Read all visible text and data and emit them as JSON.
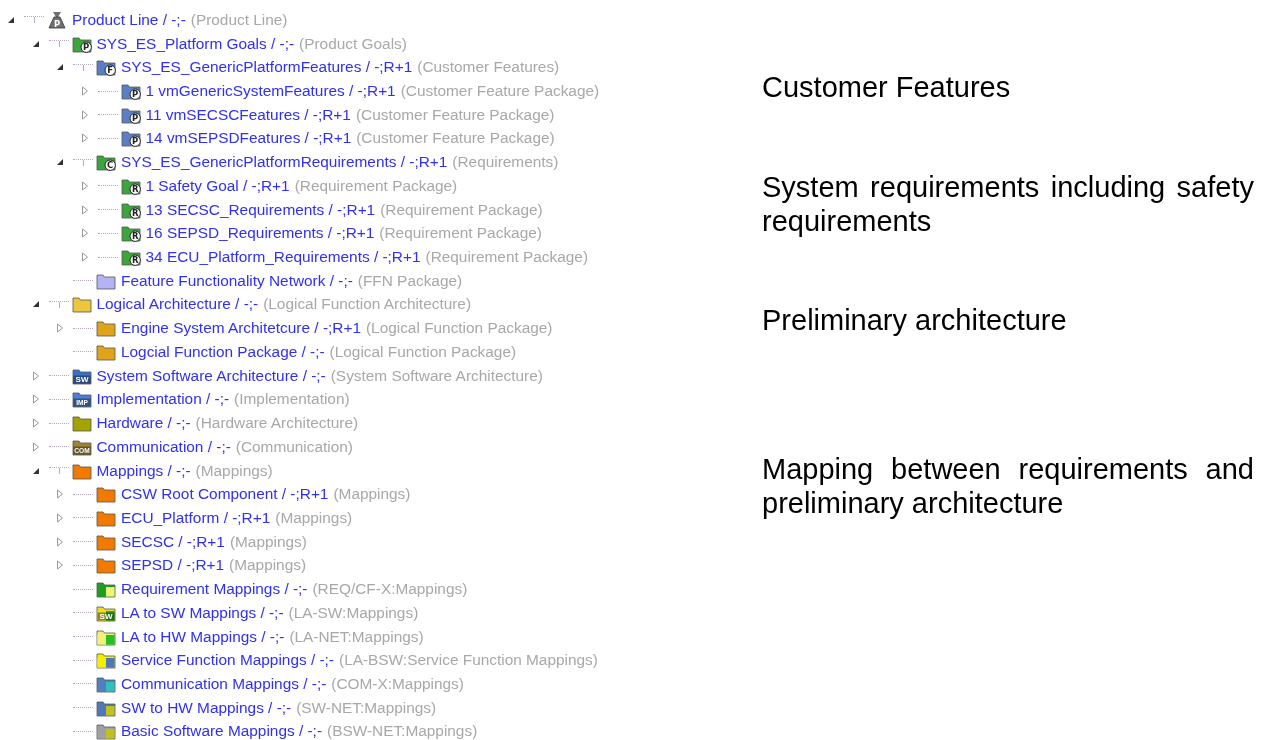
{
  "tree": [
    {
      "name": "Product Line / -;-",
      "type": "(Product Line)",
      "expanded": true,
      "icon": {
        "kind": "weight",
        "color": "#707070",
        "badge": "P"
      },
      "children": [
        {
          "name": "SYS_ES_Platform Goals / -;-",
          "type": "(Product Goals)",
          "expanded": true,
          "icon": {
            "kind": "badged",
            "color": "#3ca53c",
            "badge": "P"
          },
          "children": [
            {
              "name": "SYS_ES_GenericPlatformFeatures / -;R+1",
              "type": "(Customer Features)",
              "expanded": true,
              "icon": {
                "kind": "badged",
                "color": "#5a7fc6",
                "badge": "F"
              },
              "children": [
                {
                  "name": "1 vmGenericSystemFeatures / -;R+1",
                  "type": "(Customer Feature Package)",
                  "expanded": false,
                  "icon": {
                    "kind": "badged",
                    "color": "#5a7fc6",
                    "badge": "P"
                  }
                },
                {
                  "name": "11 vmSECSCFeatures / -;R+1",
                  "type": "(Customer Feature Package)",
                  "expanded": false,
                  "icon": {
                    "kind": "badged",
                    "color": "#5a7fc6",
                    "badge": "P"
                  }
                },
                {
                  "name": "14 vmSEPSDFeatures / -;R+1",
                  "type": "(Customer Feature Package)",
                  "expanded": false,
                  "icon": {
                    "kind": "badged",
                    "color": "#5a7fc6",
                    "badge": "P"
                  }
                }
              ]
            },
            {
              "name": "SYS_ES_GenericPlatformRequirements / -;R+1",
              "type": "(Requirements)",
              "expanded": true,
              "icon": {
                "kind": "badged",
                "color": "#3ca53c",
                "badge": "C"
              },
              "children": [
                {
                  "name": "1 Safety Goal / -;R+1",
                  "type": "(Requirement Package)",
                  "expanded": false,
                  "icon": {
                    "kind": "badged",
                    "color": "#3ca53c",
                    "badge": "R"
                  }
                },
                {
                  "name": "13 SECSC_Requirements / -;R+1",
                  "type": "(Requirement Package)",
                  "expanded": false,
                  "icon": {
                    "kind": "badged",
                    "color": "#3ca53c",
                    "badge": "R"
                  }
                },
                {
                  "name": "16 SEPSD_Requirements / -;R+1",
                  "type": "(Requirement Package)",
                  "expanded": false,
                  "icon": {
                    "kind": "badged",
                    "color": "#3ca53c",
                    "badge": "R"
                  }
                },
                {
                  "name": "34 ECU_Platform_Requirements / -;R+1",
                  "type": "(Requirement Package)",
                  "expanded": false,
                  "icon": {
                    "kind": "badged",
                    "color": "#3ca53c",
                    "badge": "R"
                  }
                }
              ]
            },
            {
              "name": "Feature Functionality Network / -;-",
              "type": "(FFN Package)",
              "icon": {
                "kind": "folder",
                "color": "#b4b4f4"
              }
            }
          ]
        },
        {
          "name": "Logical Architecture / -;-",
          "type": "(Logical Function Architecture)",
          "expanded": true,
          "icon": {
            "kind": "folder",
            "color": "#ecc63c"
          },
          "children": [
            {
              "name": "Engine System Architetcure / -;R+1",
              "type": "(Logical Function Package)",
              "expanded": false,
              "icon": {
                "kind": "folder",
                "color": "#e0a41c"
              }
            },
            {
              "name": "Logcial Function Package / -;-",
              "type": "(Logical Function Package)",
              "icon": {
                "kind": "folder",
                "color": "#e0a41c"
              }
            }
          ]
        },
        {
          "name": "System Software Architecture / -;-",
          "type": "(System Software Architecture)",
          "expanded": false,
          "icon": {
            "kind": "labeled",
            "color": "#3a6fc8",
            "badge": "SW"
          }
        },
        {
          "name": "Implementation / -;-",
          "type": "(Implementation)",
          "expanded": false,
          "icon": {
            "kind": "labeled",
            "color": "#4a80d8",
            "badge": "IMP"
          }
        },
        {
          "name": "Hardware / -;-",
          "type": "(Hardware Architecture)",
          "expanded": false,
          "icon": {
            "kind": "folder",
            "color": "#a4a400"
          }
        },
        {
          "name": "Communication / -;-",
          "type": "(Communication)",
          "expanded": false,
          "icon": {
            "kind": "labeled",
            "color": "#a08430",
            "badge": "COM"
          }
        },
        {
          "name": "Mappings / -;-",
          "type": "(Mappings)",
          "expanded": true,
          "icon": {
            "kind": "folder",
            "color": "#f27a00"
          },
          "children": [
            {
              "name": "CSW Root Component / -;R+1",
              "type": "(Mappings)",
              "expanded": false,
              "icon": {
                "kind": "folder",
                "color": "#f27a00"
              }
            },
            {
              "name": "ECU_Platform / -;R+1",
              "type": "(Mappings)",
              "expanded": false,
              "icon": {
                "kind": "folder",
                "color": "#f27a00"
              }
            },
            {
              "name": "SECSC / -;R+1",
              "type": "(Mappings)",
              "expanded": false,
              "icon": {
                "kind": "folder",
                "color": "#f27a00"
              }
            },
            {
              "name": "SEPSD / -;R+1",
              "type": "(Mappings)",
              "expanded": false,
              "icon": {
                "kind": "folder",
                "color": "#f27a00"
              }
            },
            {
              "name": "Requirement Mappings / -;-",
              "type": "(REQ/CF-X:Mappings)",
              "icon": {
                "kind": "folder",
                "color": "#1e9e1e",
                "halves": [
                  {
                    "color": "#1e9e1e"
                  },
                  {
                    "color": "#f2f27a"
                  }
                ]
              }
            },
            {
              "name": "LA to SW Mappings / -;-",
              "type": "(LA-SW:Mappings)",
              "icon": {
                "kind": "labeled",
                "color": "#eedc20",
                "halves": [
                  {
                    "color": "#eedc20"
                  },
                  {
                    "color": "#22b022"
                  }
                ],
                "badge": "SW"
              }
            },
            {
              "name": "LA to HW Mappings / -;-",
              "type": "(LA-NET:Mappings)",
              "icon": {
                "kind": "folder",
                "color": "#f0f07a",
                "halves": [
                  {
                    "color": "#f0f07a"
                  },
                  {
                    "color": "#22c022"
                  }
                ]
              }
            },
            {
              "name": "Service Function Mappings / -;-",
              "type": "(LA-BSW:Service Function Mappings)",
              "icon": {
                "kind": "folder",
                "color": "#f2f000",
                "halves": [
                  {
                    "color": "#f2f000"
                  },
                  {
                    "color": "#5078b8"
                  }
                ]
              }
            },
            {
              "name": "Communication Mappings / -;-",
              "type": "(COM-X:Mappings)",
              "icon": {
                "kind": "folder",
                "color": "#5080c0",
                "halves": [
                  {
                    "color": "#5080c0"
                  },
                  {
                    "color": "#30c0c0"
                  }
                ]
              }
            },
            {
              "name": "SW to HW Mappings / -;-",
              "type": "(SW-NET:Mappings)",
              "icon": {
                "kind": "folder",
                "color": "#5078b8",
                "halves": [
                  {
                    "color": "#5078b8"
                  },
                  {
                    "color": "#c0c020"
                  }
                ]
              }
            },
            {
              "name": "Basic Software Mappings / -;-",
              "type": "(BSW-NET:Mappings)",
              "icon": {
                "kind": "folder",
                "color": "#a0a0a0",
                "halves": [
                  {
                    "color": "#a0a0a0"
                  },
                  {
                    "color": "#c0c020"
                  }
                ]
              }
            }
          ]
        }
      ]
    }
  ],
  "annotations": [
    {
      "text": "Customer Features"
    },
    {
      "text": "System requirements including safety requirements"
    },
    {
      "text": "Preliminary architecture"
    },
    {
      "text": "Mapping between requirements and preliminary architecture"
    }
  ]
}
